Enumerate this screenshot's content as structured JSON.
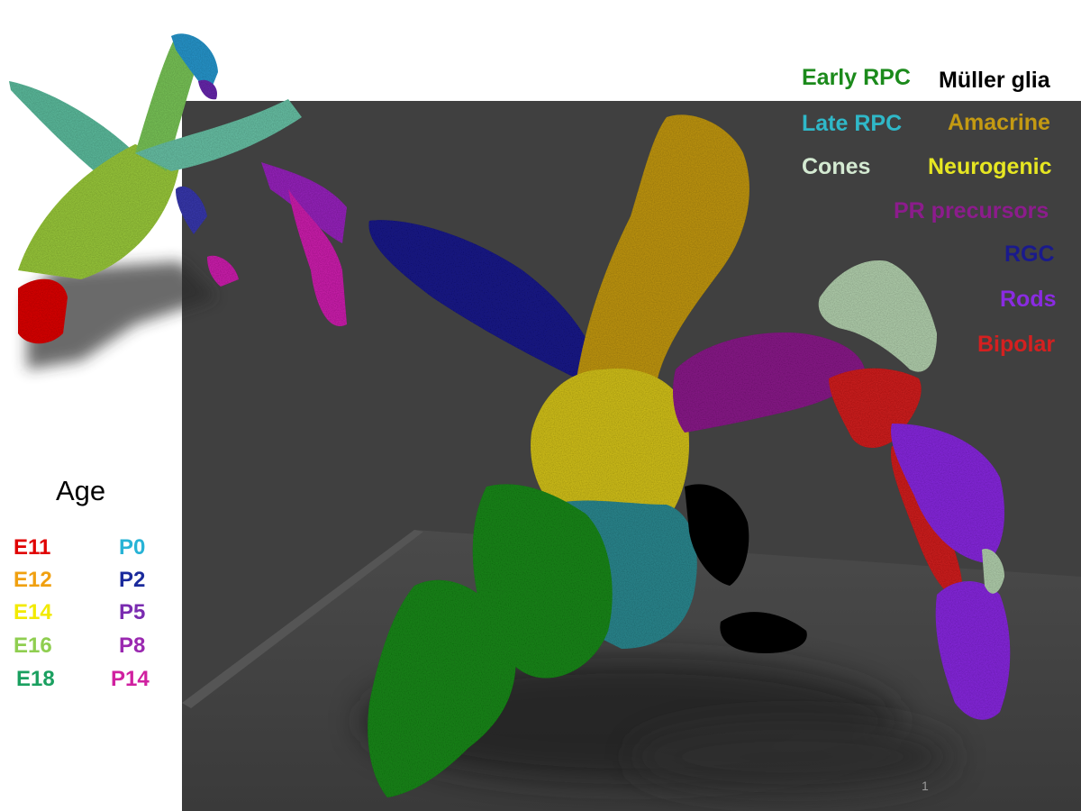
{
  "cell_type_legend": [
    {
      "label": "Early RPC",
      "color": "#1b8a1b"
    },
    {
      "label": "Müller glia",
      "color": "#000000"
    },
    {
      "label": "Late RPC",
      "color": "#2fb8c8"
    },
    {
      "label": "Amacrine",
      "color": "#c49a12"
    },
    {
      "label": "Cones",
      "color": "#d4ead2"
    },
    {
      "label": "Neurogenic",
      "color": "#e6e622"
    },
    {
      "label": "PR precursors",
      "color": "#8c1c8c"
    },
    {
      "label": "RGC",
      "color": "#1a1a8c"
    },
    {
      "label": "Rods",
      "color": "#8a2be2"
    },
    {
      "label": "Bipolar",
      "color": "#d42020"
    }
  ],
  "age_legend": {
    "title": "Age",
    "items": [
      {
        "label": "E11",
        "color": "#e00000"
      },
      {
        "label": "P0",
        "color": "#27b3d6"
      },
      {
        "label": "E12",
        "color": "#f0a010"
      },
      {
        "label": "P2",
        "color": "#1a2a9c"
      },
      {
        "label": "E14",
        "color": "#f2ea00"
      },
      {
        "label": "P5",
        "color": "#7a2bb0"
      },
      {
        "label": "E16",
        "color": "#8fce50"
      },
      {
        "label": "P8",
        "color": "#9a28b0"
      },
      {
        "label": "E18",
        "color": "#1aa060"
      },
      {
        "label": "P14",
        "color": "#d020a0"
      }
    ]
  },
  "page_number": "1"
}
